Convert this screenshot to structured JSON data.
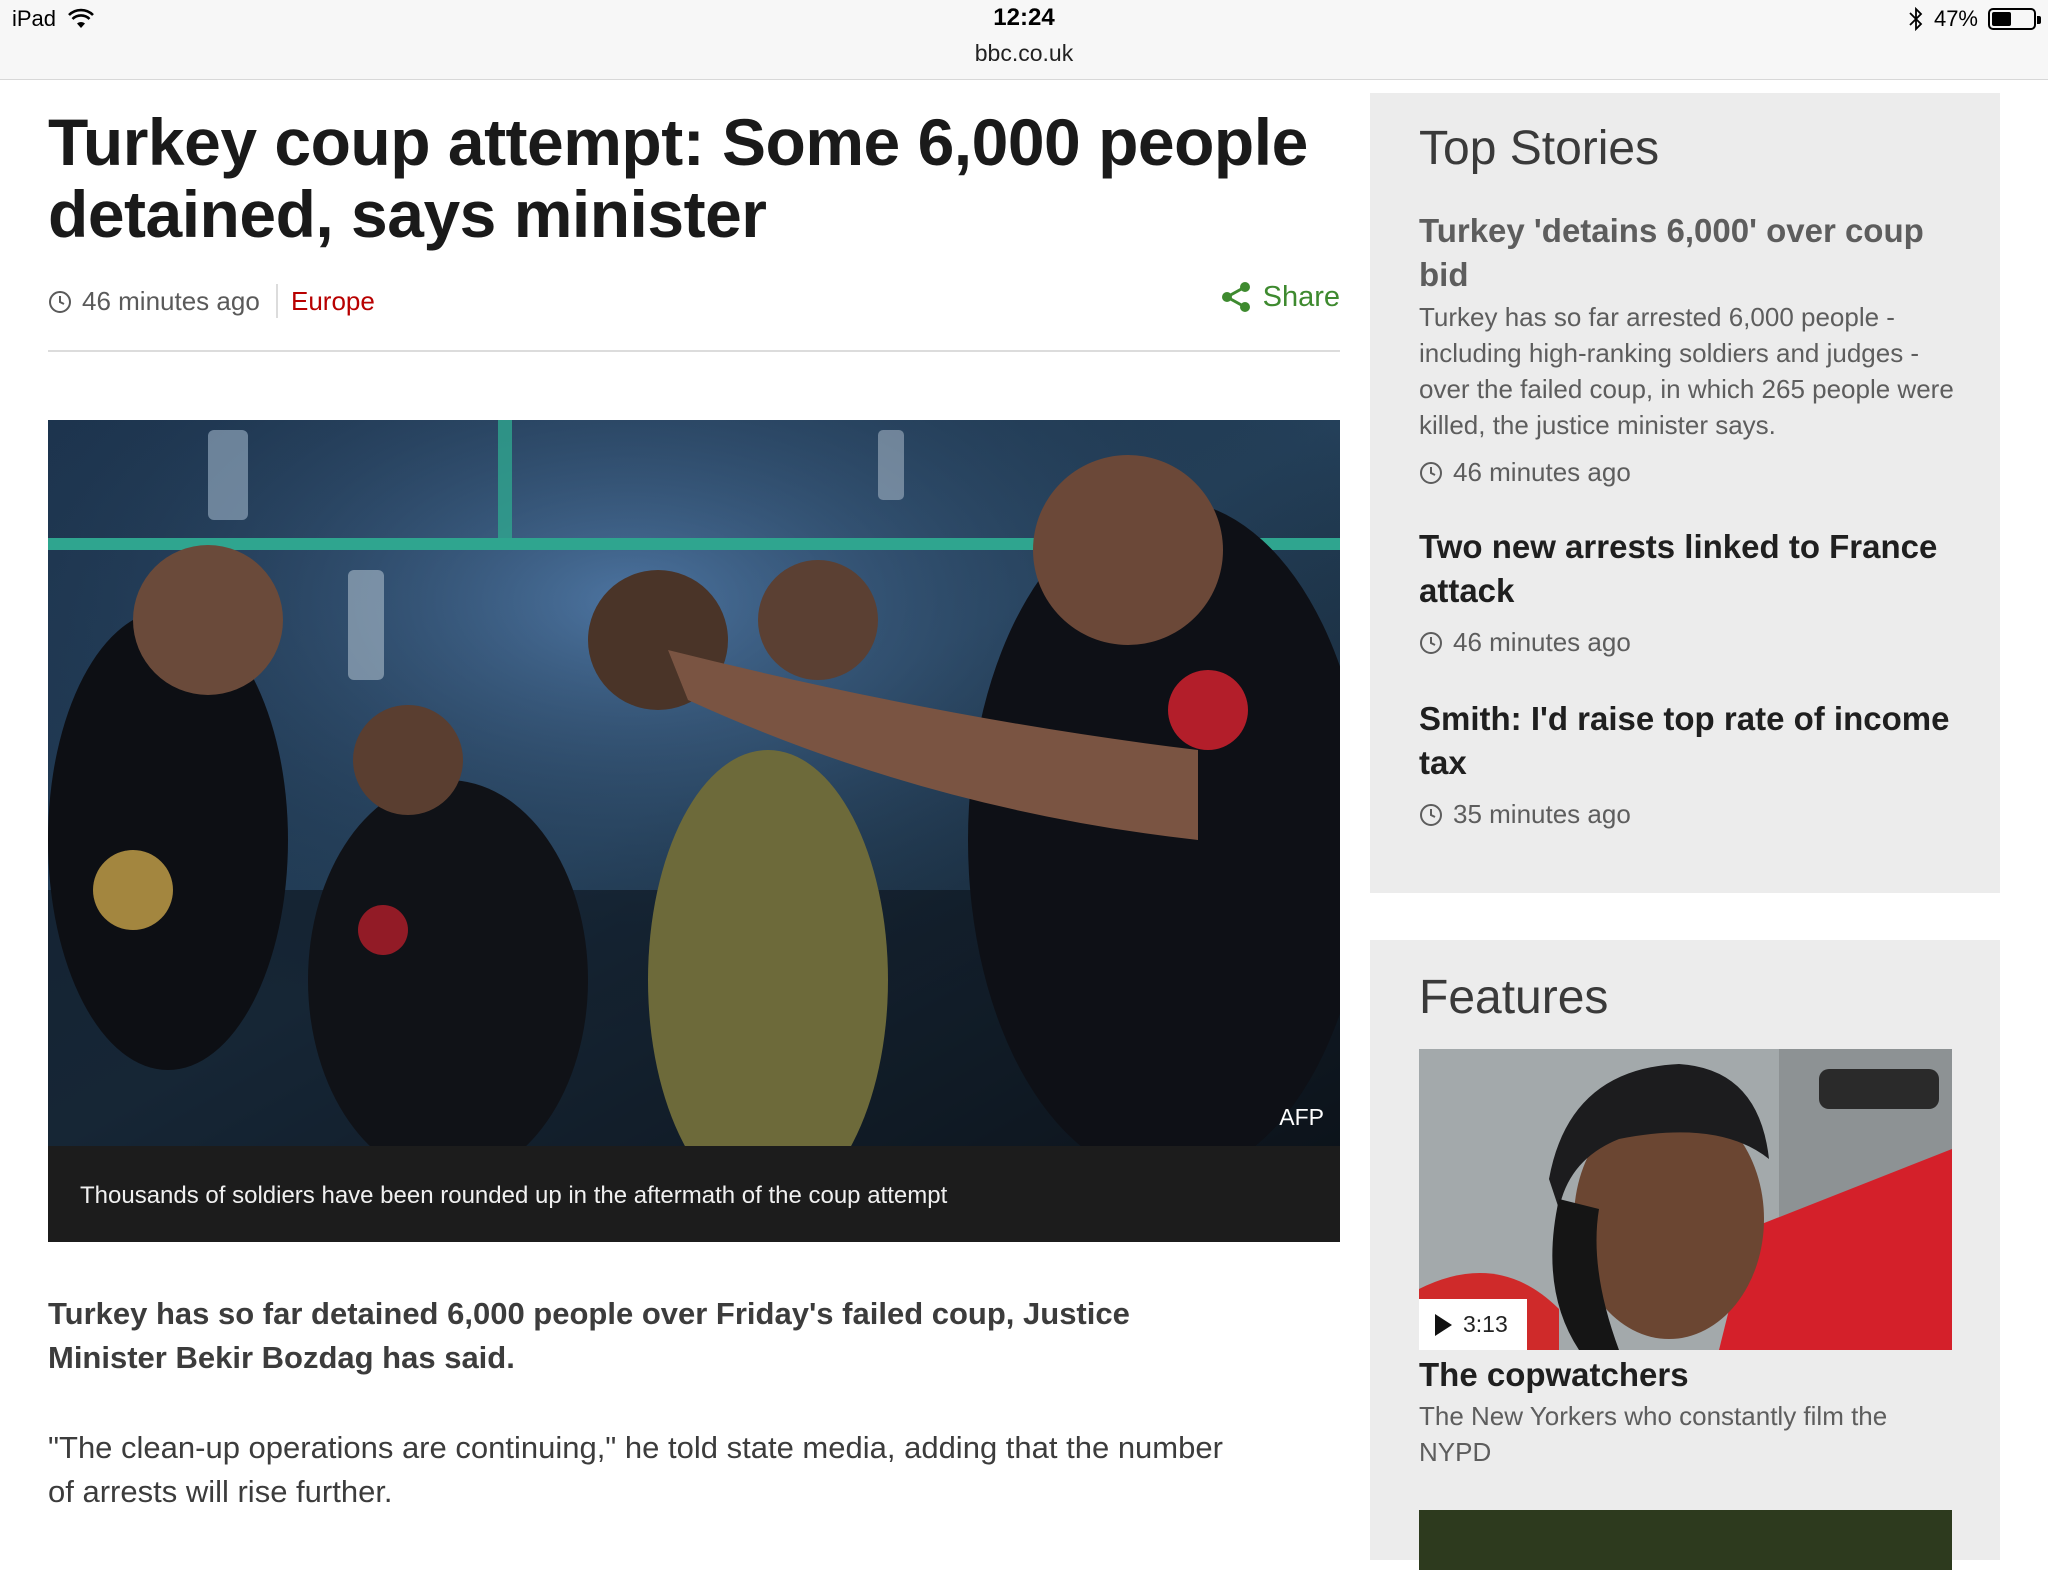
{
  "status_bar": {
    "device": "iPad",
    "time": "12:24",
    "url": "bbc.co.uk",
    "battery": "47%",
    "battery_level": 0.47
  },
  "article": {
    "headline": "Turkey coup attempt: Some 6,000 people detained, says minister",
    "timestamp": "46 minutes ago",
    "section": "Europe",
    "share_label": "Share",
    "image_credit": "AFP",
    "image_caption": "Thousands of soldiers have been rounded up in the aftermath of the coup attempt",
    "intro": "Turkey has so far detained 6,000 people over Friday's failed coup, Justice Minister Bekir Bozdag has said.",
    "paragraph": "\"The clean-up operations are continuing,\" he told state media, adding that the number of arrests will rise further."
  },
  "top_stories": {
    "title": "Top Stories",
    "items": [
      {
        "title": "Turkey 'detains 6,000' over coup bid",
        "summary": "Turkey has so far arrested 6,000 people - including high-ranking soldiers and judges - over the failed coup, in which 265 people were killed, the justice minister says.",
        "time": "46 minutes ago"
      },
      {
        "title": "Two new arrests linked to France attack",
        "time": "46 minutes ago"
      },
      {
        "title": "Smith: I'd raise top rate of income tax",
        "time": "35 minutes ago"
      }
    ]
  },
  "features": {
    "title": "Features",
    "item": {
      "duration": "3:13",
      "title": "The copwatchers",
      "summary": "The New Yorkers who constantly film the NYPD"
    }
  },
  "colors": {
    "section_red": "#b80000",
    "share_green": "#3e8a2f",
    "panel_bg": "#ececec",
    "caption_bg": "#1c1c1c"
  }
}
